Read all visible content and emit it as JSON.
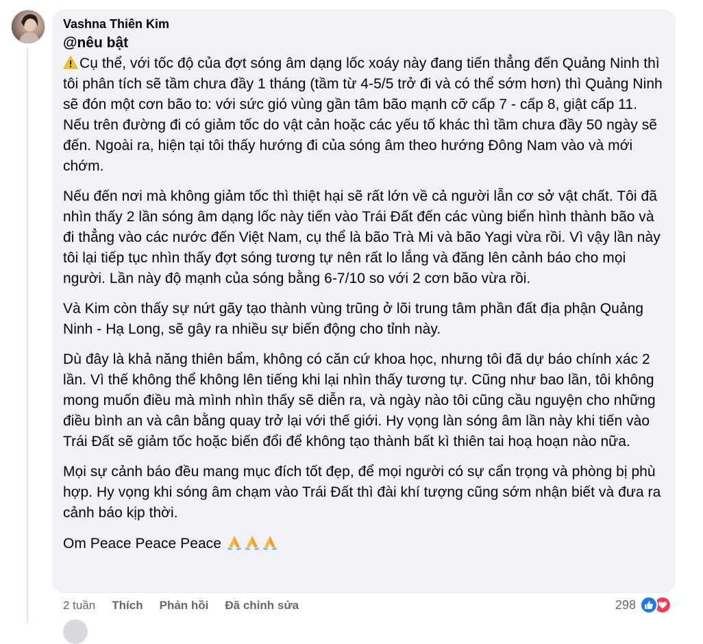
{
  "comment": {
    "author": "Vashna Thiên Kim",
    "tag": "@nêu bật",
    "paragraphs": [
      "Cụ thể, với tốc độ của đợt sóng âm dạng lốc xoáy này đang tiến thẳng đến Quảng Ninh thì tôi phân tích sẽ tầm chưa đầy 1 tháng (tầm từ 4-5/5 trở đi và có thể sớm hơn) thì Quảng Ninh sẽ đón một cơn bão to: với sức gió vùng gần tâm bão mạnh cỡ cấp 7 - cấp 8, giật cấp 11. Nếu trên đường đi có giảm tốc do vật cản hoặc các yếu tố khác thì tầm chưa đầy 50 ngày sẽ đến. Ngoài ra, hiện tại tôi thấy hướng đi của sóng âm theo hướng Đông Nam vào và mới chớm.",
      "Nếu đến nơi mà không giảm tốc thì thiệt hại sẽ rất lớn về cả người lẫn cơ sở vật chất. Tôi đã nhìn thấy 2 lần sóng âm dạng lốc này tiến vào Trái Đất đến các vùng biển hình thành bão và đi thẳng vào các nước đến Việt Nam, cụ thể là bão Trà Mi và bão Yagi vừa rồi. Vì vậy lần này tôi lại tiếp tục nhìn thấy đợt sóng tương tự nên rất lo lắng và đăng lên cảnh báo cho mọi người. Lần này độ mạnh của sóng bằng 6-7/10 so với 2 cơn bão vừa rồi.",
      "Và Kim còn thấy sự nứt gãy tạo thành vùng trũng ở lõi trung tâm phần đất địa phận Quảng Ninh - Hạ Long, sẽ gây ra nhiều sự biến động cho tỉnh này.",
      "Dù đây là khả năng thiên bẩm, không có căn cứ khoa học, nhưng tôi đã dự báo chính xác 2 lần. Vì thế không thể không lên tiếng khi lại nhìn thấy tương tự. Cũng như bao lần, tôi không mong muốn điều mà mình nhìn thấy sẽ diễn ra, và ngày nào tôi cũng cầu nguyện cho những điều bình an và cân bằng quay trở lại với thế giới. Hy vọng làn sóng âm lần này khi tiến vào Trái Đất sẽ giảm tốc hoặc biến đổi để không tạo thành bất kì thiên tai hoạ hoạn nào nữa.",
      "Mọi sự cảnh báo đều mang mục đích tốt đẹp, để mọi người có sự cẩn trọng và phòng bị phù hợp. Hy vọng khi sóng âm chạm vào Trái Đất thì đài khí tượng cũng sớm nhận biết và đưa ra cảnh báo kịp thời."
    ],
    "closing": "Om Peace Peace Peace",
    "closing_emoji": "🙏🙏🙏",
    "warning_emoji": "⚠️"
  },
  "actions": {
    "time": "2 tuần",
    "like": "Thích",
    "reply": "Phản hồi",
    "edited": "Đã chỉnh sửa"
  },
  "reactions": {
    "count": "298",
    "icons": [
      "like-icon",
      "love-icon"
    ],
    "like_color": "#1877f2",
    "love_color": "#f33e58"
  },
  "colors": {
    "bubble_bg": "#f0f2f5",
    "secondary_text": "#65676b"
  }
}
